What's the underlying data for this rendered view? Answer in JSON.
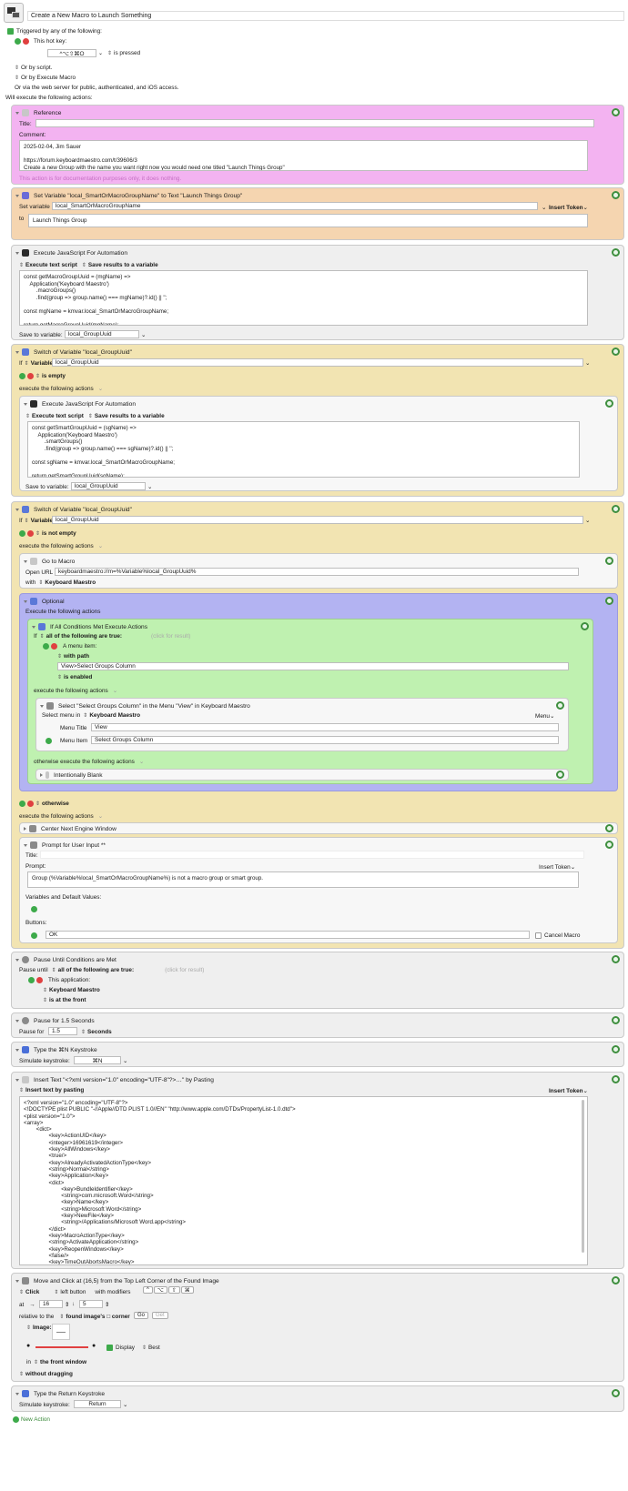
{
  "macro": {
    "name": "Create a New Macro to Launch Something",
    "triggered_label": "Triggered by any of the following:",
    "hotkey_label": "This hot key:",
    "hotkey_value": "^⌥⇧⌘O",
    "is_pressed": "is pressed",
    "or_by_script": "Or by script.",
    "or_by_execute": "Or by Execute Macro",
    "or_web": "Or via the web server for public, authenticated, and iOS access.",
    "will_execute": "Will execute the following actions:"
  },
  "reference": {
    "title": "Reference",
    "title_label": "Title:",
    "comment_label": "Comment:",
    "comment": "2025-02-04, Jim Sauer\n\nhttps://forum.keyboardmaestro.com/t/39606/3\nCreate a new Group with the name you want right now you would need one titled \"Launch Things Group\"",
    "note": "This action is for documentation purposes only, it does nothing."
  },
  "setvar": {
    "title": "Set Variable \"local_SmartOrMacroGroupName\" to Text \"Launch Things Group\"",
    "set_label": "Set variable",
    "var": "local_SmartOrMacroGroupName",
    "insert_token": "Insert Token",
    "to_label": "to",
    "value": "Launch Things Group"
  },
  "js1": {
    "title": "Execute JavaScript For Automation",
    "opt1": "Execute text script",
    "opt2": "Save results to a variable",
    "code": "const getMacroGroupUuid = (mgName) =>\n    Application('Keyboard Maestro')\n        .macroGroups()\n        .find(group => group.name() === mgName)?.id() || '';\n\nconst mgName = kmvar.local_SmartOrMacroGroupName;\n\nreturn getMacroGroupUuid(mgName);",
    "save_label": "Save to variable:",
    "save_var": "local_GroupUuid"
  },
  "switch1": {
    "title": "Switch of Variable \"local_GroupUuid\"",
    "if_label": "If",
    "variable_label": "Variable",
    "var": "local_GroupUuid",
    "cond": "is empty",
    "exec": "execute the following actions",
    "js": {
      "title": "Execute JavaScript For Automation",
      "opt1": "Execute text script",
      "opt2": "Save results to a variable",
      "code": "const getSmartGroupUuid = (sgName) =>\n    Application('Keyboard Maestro')\n        .smartGroups()\n        .find(group => group.name() === sgName)?.id() || '';\n\nconst sgName = kmvar.local_SmartOrMacroGroupName;\n\nreturn getSmartGroupUuid(sgName);",
      "save_label": "Save to variable:",
      "save_var": "local_GroupUuid"
    }
  },
  "switch2": {
    "title": "Switch of Variable \"local_GroupUuid\"",
    "if_label": "If",
    "variable_label": "Variable",
    "var": "local_GroupUuid",
    "cond": "is not empty",
    "exec": "execute the following actions",
    "goto": {
      "title": "Go to Macro",
      "open_label": "Open URL",
      "url": "keyboardmaestro://m=%Variable%local_GroupUuid%",
      "with_label": "with",
      "with_app": "Keyboard Maestro"
    },
    "optional": {
      "title": "Optional",
      "exec": "Execute the following actions",
      "ifall": {
        "title": "If All Conditions Met Execute Actions",
        "if_label": "If",
        "all_true": "all of the following are true:",
        "click_result": "(click for result)",
        "menu_item": "A menu item:",
        "with_path": "with path",
        "path": "View>Select Groups Column",
        "is_enabled": "is enabled",
        "exec": "execute the following actions",
        "select": {
          "title": "Select \"Select Groups Column\" in the Menu \"View\" in Keyboard Maestro",
          "select_in": "Select menu in",
          "app": "Keyboard Maestro",
          "menu": "Menu",
          "menu_title_label": "Menu Title",
          "menu_title": "View",
          "menu_item_label": "Menu Item",
          "menu_item": "Select Groups Column"
        },
        "otherwise": "otherwise execute the following actions",
        "blank": "Intentionally Blank"
      }
    },
    "otherwise": "otherwise",
    "exec2": "execute the following actions",
    "center": "Center Next Engine Window",
    "prompt": {
      "title": "Prompt for User Input **",
      "title_label": "Title:",
      "prompt_label": "Prompt:",
      "insert_token": "Insert Token",
      "prompt_text": "Group (%Variable%local_SmartOrMacroGroupName%) is not a macro group or smart group.",
      "vars_label": "Variables and Default Values:",
      "buttons_label": "Buttons:",
      "button": "OK",
      "cancel": "Cancel Macro"
    }
  },
  "pause_until": {
    "title": "Pause Until Conditions are Met",
    "pause_label": "Pause until",
    "all_true": "all of the following are true:",
    "click_result": "(click for result)",
    "this_app": "This application:",
    "app": "Keyboard Maestro",
    "front": "is at the front"
  },
  "pause": {
    "title": "Pause for 1.5 Seconds",
    "label": "Pause for",
    "value": "1.5",
    "unit": "Seconds"
  },
  "type_n": {
    "title": "Type the ⌘N Keystroke",
    "label": "Simulate keystroke:",
    "value": "⌘N"
  },
  "insert": {
    "title": "Insert Text \"<?xml version=\"1.0\" encoding=\"UTF-8\"?>…\" by Pasting",
    "opt": "Insert text by pasting",
    "insert_token": "Insert Token",
    "text": "<?xml version=\"1.0\" encoding=\"UTF-8\"?>\n<!DOCTYPE plist PUBLIC \"-//Apple//DTD PLIST 1.0//EN\" \"http://www.apple.com/DTDs/PropertyList-1.0.dtd\">\n<plist version=\"1.0\">\n<array>\n        <dict>\n                <key>ActionUID</key>\n                <integer>16961619</integer>\n                <key>AllWindows</key>\n                <true/>\n                <key>AlreadyActivatedActionType</key>\n                <string>Normal</string>\n                <key>Application</key>\n                <dict>\n                        <key>BundleIdentifier</key>\n                        <string>com.microsoft.Word</string>\n                        <key>Name</key>\n                        <string>Microsoft Word</string>\n                        <key>NewFile</key>\n                        <string>/Applications/Microsoft Word.app</string>\n                </dict>\n                <key>MacroActionType</key>\n                <string>ActivateApplication</string>\n                <key>ReopenWindows</key>\n                <false/>\n                <key>TimeOutAbortsMacro</key>"
  },
  "move_click": {
    "title": "Move and Click at (16,5) from the Top Left Corner of the Found Image",
    "click": "Click",
    "button": "left button",
    "modifiers": "with modifiers",
    "mods": [
      "^",
      "⌥",
      "⇧",
      "⌘"
    ],
    "at_label": "at",
    "x": "16",
    "y": "5",
    "relative": "relative to the",
    "corner": "found image's □ corner",
    "go": "Go",
    "get": "Get",
    "image_label": "Image:",
    "display": "Display",
    "best": "Best",
    "in_label": "in",
    "window": "the front window",
    "drag": "without dragging"
  },
  "type_return": {
    "title": "Type the Return Keystroke",
    "label": "Simulate keystroke:",
    "value": "Return"
  },
  "new_action": "New Action"
}
